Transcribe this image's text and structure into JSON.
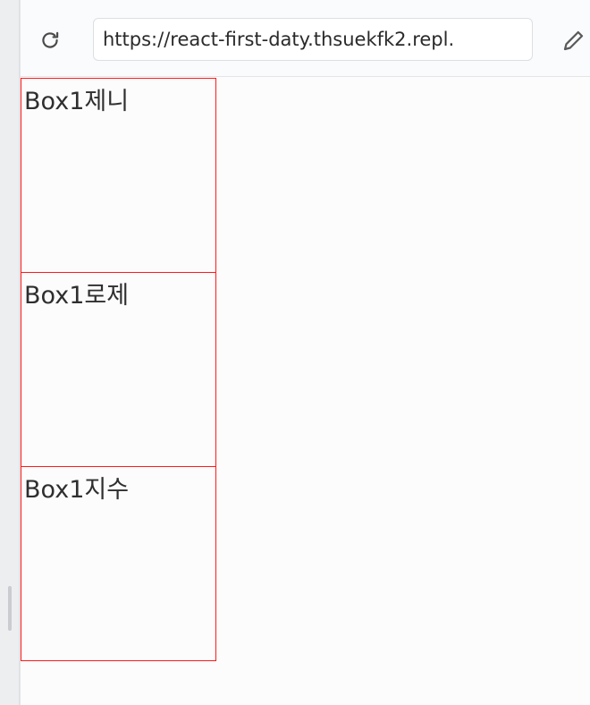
{
  "browser": {
    "url": "https://react-first-daty.thsuekfk2.repl.",
    "reload_icon": "reload-icon",
    "edit_icon": "pencil-icon"
  },
  "boxes": [
    {
      "label": "Box1제니"
    },
    {
      "label": "Box1로제"
    },
    {
      "label": "Box1지수"
    }
  ],
  "colors": {
    "box_border": "#ff1a1a",
    "page_background": "#fcfcfd"
  }
}
